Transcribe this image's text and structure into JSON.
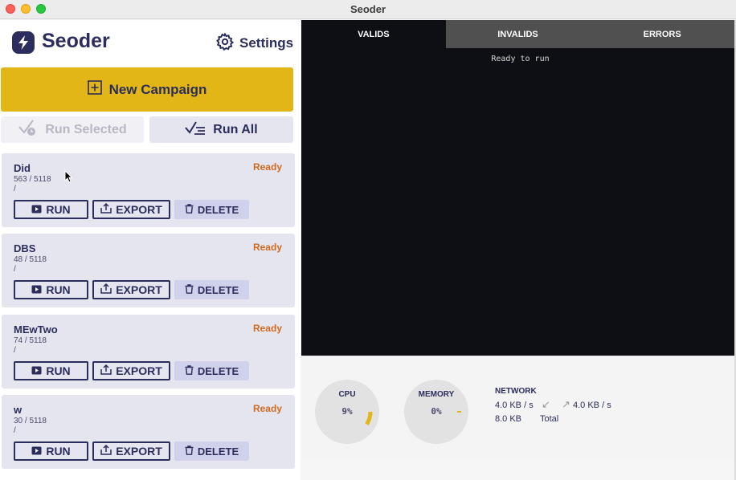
{
  "window": {
    "title": "Seoder"
  },
  "brand": {
    "name": "Seoder",
    "icon": "bolt-icon"
  },
  "settings": {
    "label": "Settings",
    "icon": "gear-icon"
  },
  "actions": {
    "new_campaign": "New Campaign",
    "run_selected": "Run Selected",
    "run_all": "Run All"
  },
  "campaigns": [
    {
      "name": "Did",
      "count": "563 / 5118",
      "path": "/",
      "status": "Ready",
      "run": "RUN",
      "export": "EXPORT",
      "delete": "DELETE"
    },
    {
      "name": "DBS",
      "count": "48 / 5118",
      "path": "/",
      "status": "Ready",
      "run": "RUN",
      "export": "EXPORT",
      "delete": "DELETE"
    },
    {
      "name": "MEwTwo",
      "count": "74 / 5118",
      "path": "/",
      "status": "Ready",
      "run": "RUN",
      "export": "EXPORT",
      "delete": "DELETE"
    },
    {
      "name": "w",
      "count": "30 / 5118",
      "path": "/",
      "status": "Ready",
      "run": "RUN",
      "export": "EXPORT",
      "delete": "DELETE"
    }
  ],
  "console": {
    "tabs": [
      "VALIDS",
      "INVALIDS",
      "ERRORS"
    ],
    "active_tab": "VALIDS",
    "text": "Ready to run"
  },
  "monitor": {
    "cpu": {
      "label": "CPU",
      "value": "9%",
      "fraction": 0.09
    },
    "memory": {
      "label": "MEMORY",
      "value": "0%",
      "fraction": 0.0
    },
    "network": {
      "label": "NETWORK",
      "down": "4.0 KB / s",
      "up": "4.0 KB / s",
      "total_value": "8.0 KB",
      "total_label": "Total"
    }
  },
  "colors": {
    "brand_navy": "#2b2d5c",
    "accent_yellow": "#e3b617",
    "status_ready": "#d2691e",
    "console_bg": "#0e0f14",
    "card_bg": "#e4e5ef"
  }
}
